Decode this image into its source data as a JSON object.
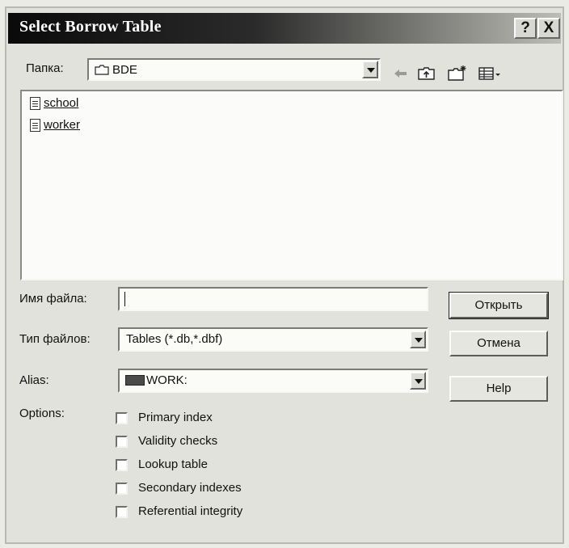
{
  "window": {
    "title": "Select Borrow Table",
    "help_glyph": "?",
    "close_glyph": "X"
  },
  "folder": {
    "label": "Папка:",
    "value": "BDE"
  },
  "toolbar": {
    "icons": [
      "back-arrow-icon",
      "up-folder-icon",
      "new-folder-icon",
      "view-menu-icon"
    ]
  },
  "files": [
    {
      "name": "school"
    },
    {
      "name": "worker"
    }
  ],
  "filename": {
    "label": "Имя файла:",
    "value": ""
  },
  "filetype": {
    "label": "Тип файлов:",
    "value": "Tables (*.db,*.dbf)"
  },
  "alias": {
    "label": "Alias:",
    "value": "WORK:"
  },
  "options": {
    "label": "Options:",
    "items": [
      {
        "label": "Primary index",
        "checked": false
      },
      {
        "label": "Validity checks",
        "checked": false
      },
      {
        "label": "Lookup table",
        "checked": false
      },
      {
        "label": "Secondary indexes",
        "checked": false
      },
      {
        "label": "Referential integrity",
        "checked": false
      }
    ]
  },
  "buttons": {
    "open": "Открыть",
    "cancel": "Отмена",
    "help": "Help"
  },
  "colors": {
    "titlebar_start": "#0a0a0a",
    "titlebar_end": "#bdbdb8",
    "dialog_face": "#e2e2dc"
  }
}
